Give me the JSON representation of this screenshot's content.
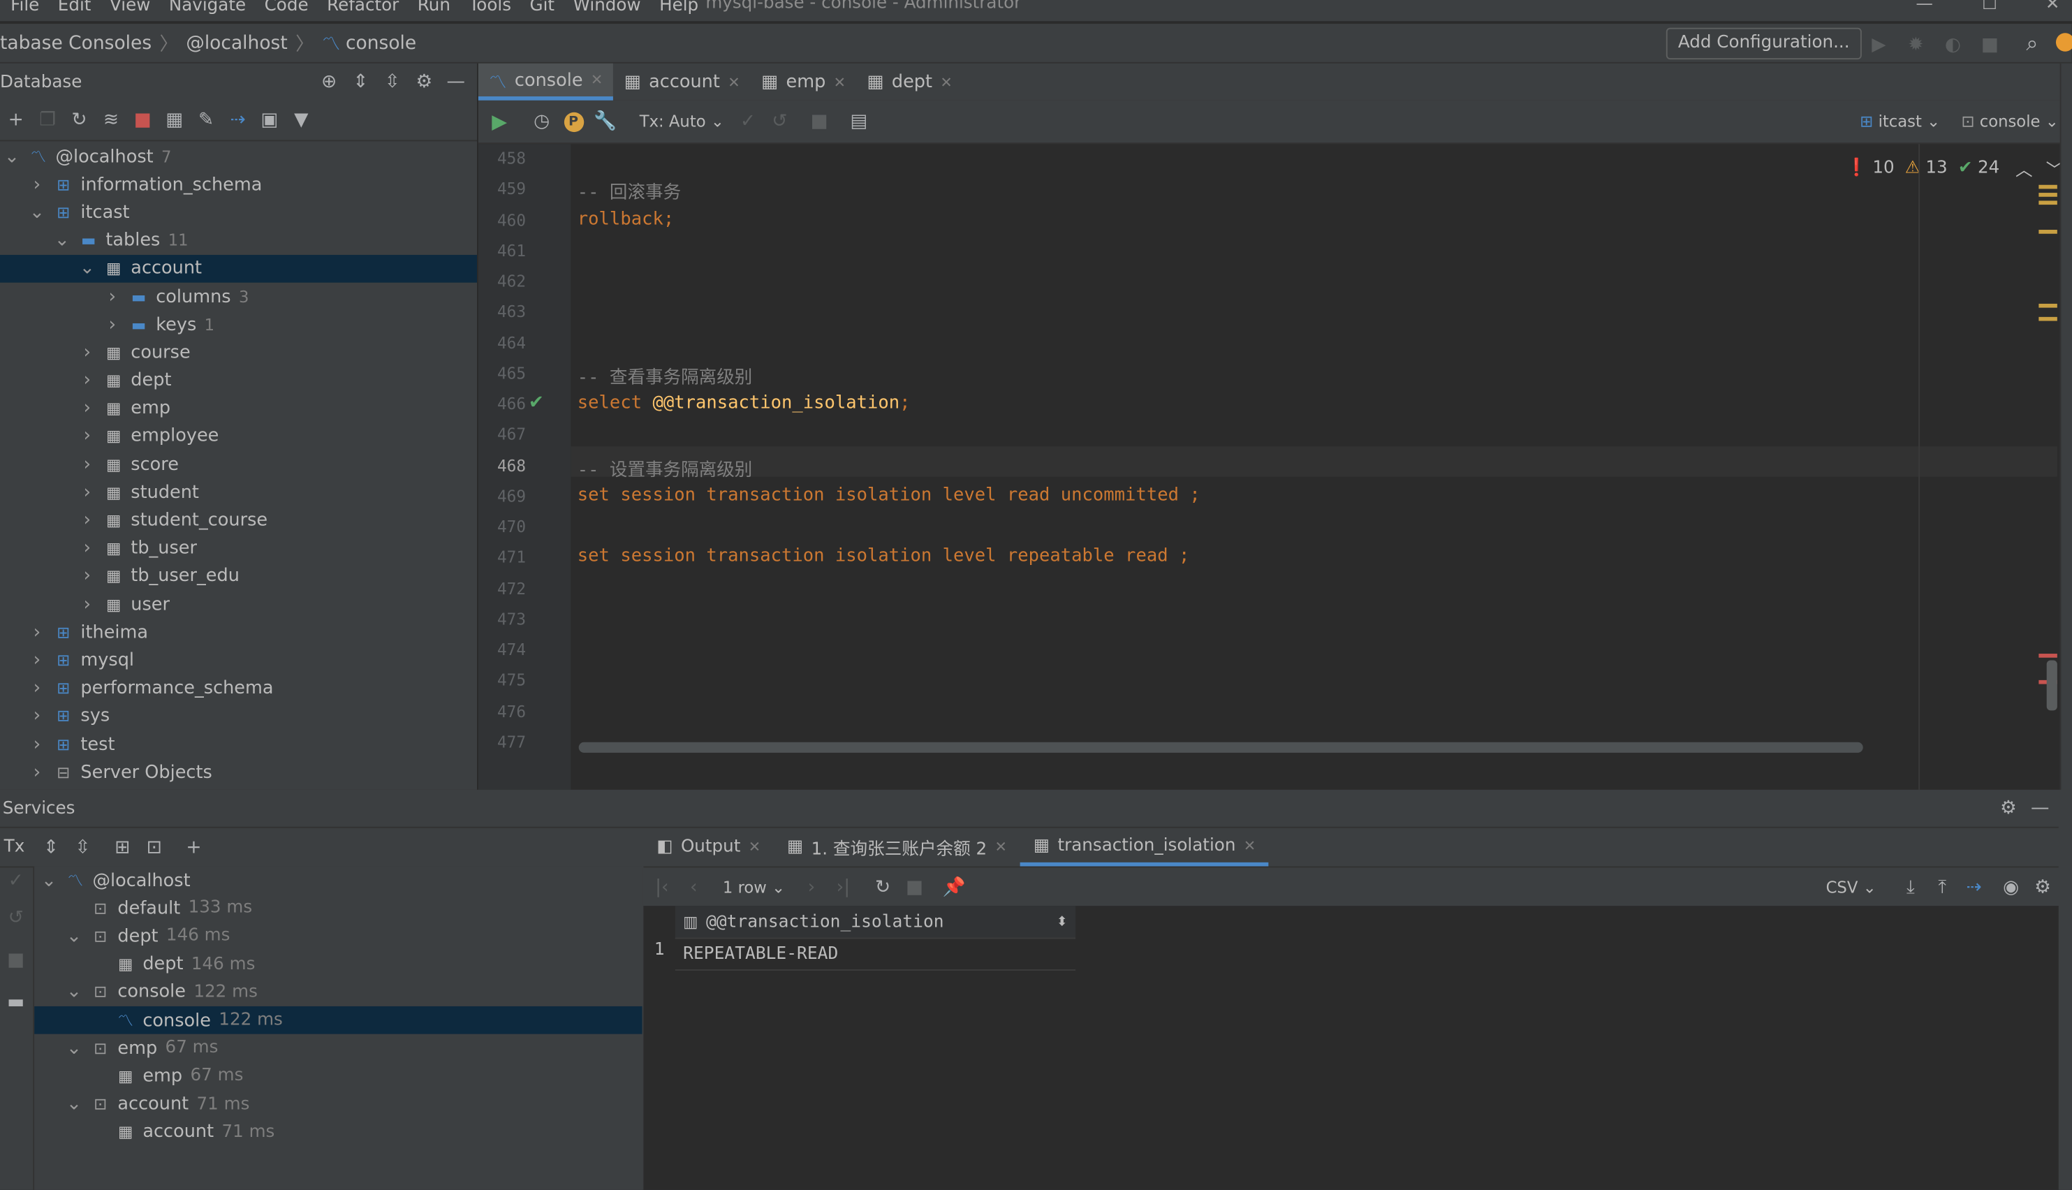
{
  "menu": {
    "items": [
      "File",
      "Edit",
      "View",
      "Navigate",
      "Code",
      "Refactor",
      "Run",
      "Tools",
      "Git",
      "Window",
      "Help"
    ],
    "window_title": "mysql-base - console - Administrator"
  },
  "navbar": {
    "breadcrumbs": [
      "tabase Consoles",
      "@localhost",
      "console"
    ],
    "add_config": "Add Configuration..."
  },
  "database_panel": {
    "title": "Database",
    "tree": [
      {
        "label": "@localhost",
        "count": "7",
        "depth": 0,
        "open": true,
        "icon": "host-icon"
      },
      {
        "label": "information_schema",
        "depth": 1,
        "icon": "schema-icon"
      },
      {
        "label": "itcast",
        "depth": 1,
        "open": true,
        "icon": "schema-icon"
      },
      {
        "label": "tables",
        "count": "11",
        "depth": 2,
        "open": true,
        "icon": "folder-icon"
      },
      {
        "label": "account",
        "depth": 3,
        "open": true,
        "selected": true,
        "icon": "table-icon"
      },
      {
        "label": "columns",
        "count": "3",
        "depth": 4,
        "icon": "folder-icon"
      },
      {
        "label": "keys",
        "count": "1",
        "depth": 4,
        "icon": "folder-icon"
      },
      {
        "label": "course",
        "depth": 3,
        "icon": "table-icon"
      },
      {
        "label": "dept",
        "depth": 3,
        "icon": "table-icon"
      },
      {
        "label": "emp",
        "depth": 3,
        "icon": "table-icon"
      },
      {
        "label": "employee",
        "depth": 3,
        "icon": "table-icon"
      },
      {
        "label": "score",
        "depth": 3,
        "icon": "table-icon"
      },
      {
        "label": "student",
        "depth": 3,
        "icon": "table-icon"
      },
      {
        "label": "student_course",
        "depth": 3,
        "icon": "table-icon"
      },
      {
        "label": "tb_user",
        "depth": 3,
        "icon": "table-icon"
      },
      {
        "label": "tb_user_edu",
        "depth": 3,
        "icon": "table-icon"
      },
      {
        "label": "user",
        "depth": 3,
        "icon": "table-icon"
      },
      {
        "label": "itheima",
        "depth": 1,
        "icon": "schema-icon"
      },
      {
        "label": "mysql",
        "depth": 1,
        "icon": "schema-icon"
      },
      {
        "label": "performance_schema",
        "depth": 1,
        "icon": "schema-icon"
      },
      {
        "label": "sys",
        "depth": 1,
        "icon": "schema-icon"
      },
      {
        "label": "test",
        "depth": 1,
        "icon": "schema-icon"
      },
      {
        "label": "Server Objects",
        "depth": 1,
        "icon": "server-objects-icon"
      }
    ]
  },
  "editor": {
    "tabs": [
      {
        "label": "console",
        "active": true
      },
      {
        "label": "account"
      },
      {
        "label": "emp"
      },
      {
        "label": "dept"
      }
    ],
    "tx_mode": "Tx: Auto",
    "schema_selector": "itcast",
    "console_selector": "console",
    "inspections": {
      "errors": "10",
      "warnings": "13",
      "ok": "24"
    },
    "current_line": "468",
    "lines": [
      {
        "n": "458",
        "parts": []
      },
      {
        "n": "459",
        "parts": [
          {
            "t": "-- 回滚事务",
            "c": "cmt"
          }
        ]
      },
      {
        "n": "460",
        "parts": [
          {
            "t": "rollback;",
            "c": "kw"
          }
        ]
      },
      {
        "n": "461",
        "parts": []
      },
      {
        "n": "462",
        "parts": []
      },
      {
        "n": "463",
        "parts": []
      },
      {
        "n": "464",
        "parts": []
      },
      {
        "n": "465",
        "parts": [
          {
            "t": "-- 查看事务隔离级别",
            "c": "cmt"
          }
        ]
      },
      {
        "n": "466",
        "check": true,
        "parts": [
          {
            "t": "select ",
            "c": "kw"
          },
          {
            "t": "@@transaction_isolation",
            "c": "var"
          },
          {
            "t": ";",
            "c": "kw"
          }
        ]
      },
      {
        "n": "467",
        "parts": []
      },
      {
        "n": "468",
        "parts": [
          {
            "t": "-- 设置事务隔离级别",
            "c": "cmt"
          }
        ]
      },
      {
        "n": "469",
        "parts": [
          {
            "t": "set session transaction isolation level read uncommitted ;",
            "c": "kw"
          }
        ]
      },
      {
        "n": "470",
        "parts": []
      },
      {
        "n": "471",
        "parts": [
          {
            "t": "set session transaction isolation level repeatable read ;",
            "c": "kw"
          }
        ]
      },
      {
        "n": "472",
        "parts": []
      },
      {
        "n": "473",
        "parts": []
      },
      {
        "n": "474",
        "parts": []
      },
      {
        "n": "475",
        "parts": []
      },
      {
        "n": "476",
        "parts": []
      },
      {
        "n": "477",
        "parts": []
      }
    ]
  },
  "services": {
    "title": "Services",
    "tx_label": "Tx",
    "tree": [
      {
        "label": "@localhost",
        "depth": 0,
        "open": true,
        "icon": "console-icon"
      },
      {
        "label": "default",
        "ms": "133 ms",
        "depth": 1,
        "icon": "session-icon"
      },
      {
        "label": "dept",
        "ms": "146 ms",
        "depth": 1,
        "open": true,
        "icon": "session-icon"
      },
      {
        "label": "dept",
        "ms": "146 ms",
        "depth": 2,
        "icon": "table-icon"
      },
      {
        "label": "console",
        "ms": "122 ms",
        "depth": 1,
        "open": true,
        "icon": "session-icon"
      },
      {
        "label": "console",
        "ms": "122 ms",
        "depth": 2,
        "selected": true,
        "icon": "console-icon"
      },
      {
        "label": "emp",
        "ms": "67 ms",
        "depth": 1,
        "open": true,
        "icon": "session-icon"
      },
      {
        "label": "emp",
        "ms": "67 ms",
        "depth": 2,
        "icon": "table-icon"
      },
      {
        "label": "account",
        "ms": "71 ms",
        "depth": 1,
        "open": true,
        "icon": "session-icon"
      },
      {
        "label": "account",
        "ms": "71 ms",
        "depth": 2,
        "icon": "table-icon"
      }
    ],
    "result_tabs": [
      {
        "label": "Output"
      },
      {
        "label": "1. 查询张三账户余额 2"
      },
      {
        "label": "transaction_isolation",
        "active": true
      }
    ],
    "rows_label": "1 row",
    "export_format": "CSV",
    "column_header": "@@transaction_isolation",
    "row_number": "1",
    "cell_value": "REPEATABLE-READ"
  }
}
